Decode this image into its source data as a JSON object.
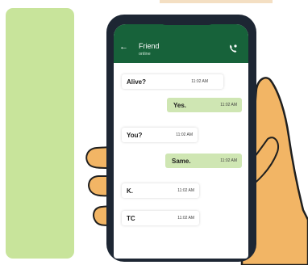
{
  "colors": {
    "side_panel": "#c8e49b",
    "phone_body": "#1d2633",
    "chat_header": "#17623a",
    "outgoing_bubble": "#cfe6b3",
    "incoming_bubble": "#ffffff",
    "skin": "#f2b565"
  },
  "chat": {
    "contact_name": "Friend",
    "contact_status": "online",
    "back_icon": "arrow-left",
    "call_icon": "phone-handset",
    "messages": [
      {
        "direction": "in",
        "text": "Alive?",
        "time": "11:02 AM"
      },
      {
        "direction": "out",
        "text": "Yes.",
        "time": "11:02 AM"
      },
      {
        "direction": "in",
        "text": "You?",
        "time": "11:02 AM"
      },
      {
        "direction": "out",
        "text": "Same.",
        "time": "11:02 AM"
      },
      {
        "direction": "in",
        "text": "K.",
        "time": "11:02 AM"
      },
      {
        "direction": "in",
        "text": "TC",
        "time": "11:02 AM"
      }
    ]
  }
}
